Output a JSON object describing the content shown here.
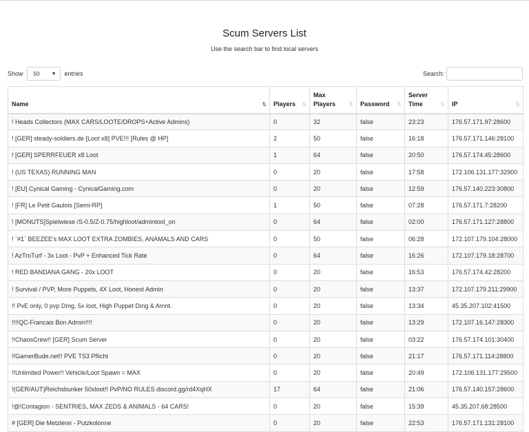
{
  "page": {
    "title": "Scum Servers List",
    "subtitle": "Use the search bar to find local servers"
  },
  "length_menu": {
    "show_label": "Show",
    "selected": "50",
    "entries_label": "entries"
  },
  "search": {
    "label": "Search:",
    "value": "",
    "placeholder": ""
  },
  "table": {
    "sort_column": "Name",
    "headers": {
      "name": "Name",
      "players": "Players",
      "max_players": "Max Players",
      "password": "Password",
      "server_time": "Server Time",
      "ip": "IP"
    },
    "rows": [
      [
        "! Heads Collectors (MAX CARS/LOOTE/DROPS+Active Admins)",
        "0",
        "32",
        "false",
        "23:23",
        "176.57.171.97:28600"
      ],
      [
        "! [GER] steady-soldiers.de [Loot x8] PVE!!! [Rules @ HP]",
        "2",
        "50",
        "false",
        "16:18",
        "176.57.171.146:28100"
      ],
      [
        "! [GER] SPERRFEUER x8 Loot",
        "1",
        "64",
        "false",
        "20:50",
        "176.57.174.45:28600"
      ],
      [
        "! (US TEXAS) RUNNING MAN",
        "0",
        "20",
        "false",
        "17:58",
        "172.106.131.177:32900"
      ],
      [
        "! [EU] Cynical Gaming - CynicalGaming.com",
        "0",
        "20",
        "false",
        "12:59",
        "176.57.140.223:30800"
      ],
      [
        "! [FR] Le Petit Gaulois [Semi-RP]",
        "1",
        "50",
        "false",
        "07:28",
        "176.57.171.7:28200"
      ],
      [
        "! [MONUTS]Spielwiese /S-0.5/Z-0.75/highloot/admintool_on",
        "0",
        "64",
        "false",
        "02:00",
        "176.57.171.127:28800"
      ],
      [
        "! `#1` BEEZEE's MAX LOOT EXTRA ZOMBIES, ANAMALS AND CARS",
        "0",
        "50",
        "false",
        "06:28",
        "172.107.179.104:28000"
      ],
      [
        "! AzTroTurf - 3x Loot - PvP + Enhanced Tick Rate",
        "0",
        "64",
        "false",
        "16:26",
        "172.107.179.18:28700"
      ],
      [
        "! RED BANDANA GANG - 20x LOOT",
        "0",
        "20",
        "false",
        "16:53",
        "176.57.174.42:28200"
      ],
      [
        "! Survival / PVP, More Puppets, 4X Loot, Honest Admin",
        "0",
        "20",
        "false",
        "13:37",
        "172.107.179.211:29900"
      ],
      [
        "!! PvE only, 0 pvp Dmg, 5x loot, High Puppet Dmg & Amnt.",
        "0",
        "20",
        "false",
        "13:34",
        "45.35.207.102:41500"
      ],
      [
        "!!!!QC-Francais Bon Admin!!!!",
        "0",
        "20",
        "false",
        "13:29",
        "172.107.16.147:28300"
      ],
      [
        "!!ChaosCrew!! [GER] Scum Server",
        "0",
        "20",
        "false",
        "03:22",
        "176.57.174.101:30400"
      ],
      [
        "!!GamerBude.net!! PVE TS3 Pflicht",
        "0",
        "20",
        "false",
        "21:17",
        "176.57.171.114:28800"
      ],
      [
        "!!Unlimited Power!! Vehicle/Loot Spawn = MAX",
        "0",
        "20",
        "false",
        "20:49",
        "172.106.131.177:29500"
      ],
      [
        "!(GER/AUT)Reichsbunker 50xloot!! PvP/NO RULES discord.gg/rd4XqHX",
        "17",
        "64",
        "false",
        "21:06",
        "176.57.140.157:28600"
      ],
      [
        "!@!Contagion - SENTRIES, MAX ZEDS & ANIMALS - 64 CARS!",
        "0",
        "20",
        "false",
        "15:39",
        "45.35.207.68:28500"
      ],
      [
        "# [GER] Die Metzlerei - Putzkolonne",
        "0",
        "20",
        "false",
        "22:53",
        "176.57.171.131:28100"
      ]
    ]
  }
}
